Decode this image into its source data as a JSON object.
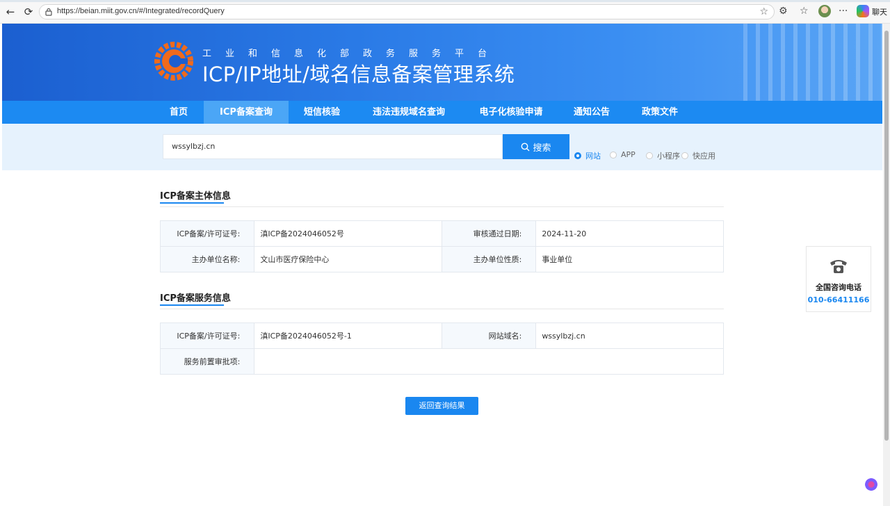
{
  "browser": {
    "url": "https://beian.miit.gov.cn/#/Integrated/recordQuery",
    "chat_label": "聊天"
  },
  "header": {
    "subtitle": "工业和信息化部政务服务平台",
    "title": "ICP/IP地址/域名信息备案管理系统"
  },
  "nav": {
    "items": [
      {
        "label": "首页"
      },
      {
        "label": "ICP备案查询"
      },
      {
        "label": "短信核验"
      },
      {
        "label": "违法违规域名查询"
      },
      {
        "label": "电子化核验申请"
      },
      {
        "label": "通知公告"
      },
      {
        "label": "政策文件"
      }
    ],
    "active_index": 1
  },
  "search": {
    "value": "wssylbzj.cn",
    "button_label": "搜索",
    "types": [
      {
        "label": "网站",
        "selected": true
      },
      {
        "label": "APP",
        "selected": false
      },
      {
        "label": "小程序",
        "selected": false
      },
      {
        "label": "快应用",
        "selected": false
      }
    ]
  },
  "subject": {
    "title": "ICP备案主体信息",
    "rows": [
      {
        "l1": "ICP备案/许可证号:",
        "v1": "滇ICP备2024046052号",
        "l2": "审核通过日期:",
        "v2": "2024-11-20"
      },
      {
        "l1": "主办单位名称:",
        "v1": "文山市医疗保险中心",
        "l2": "主办单位性质:",
        "v2": "事业单位"
      }
    ]
  },
  "service": {
    "title": "ICP备案服务信息",
    "rows": [
      {
        "l1": "ICP备案/许可证号:",
        "v1": "滇ICP备2024046052号-1",
        "l2": "网站域名:",
        "v2": "wssylbzj.cn"
      }
    ],
    "pre_approval_label": "服务前置审批项:",
    "pre_approval_value": ""
  },
  "back_button": "返回查询结果",
  "hotline": {
    "title": "全国咨询电话",
    "number": "010-66411166"
  },
  "colors": {
    "accent": "#1a87f0",
    "nav": "#1c8af2",
    "nav_active": "#4ba6f6"
  }
}
